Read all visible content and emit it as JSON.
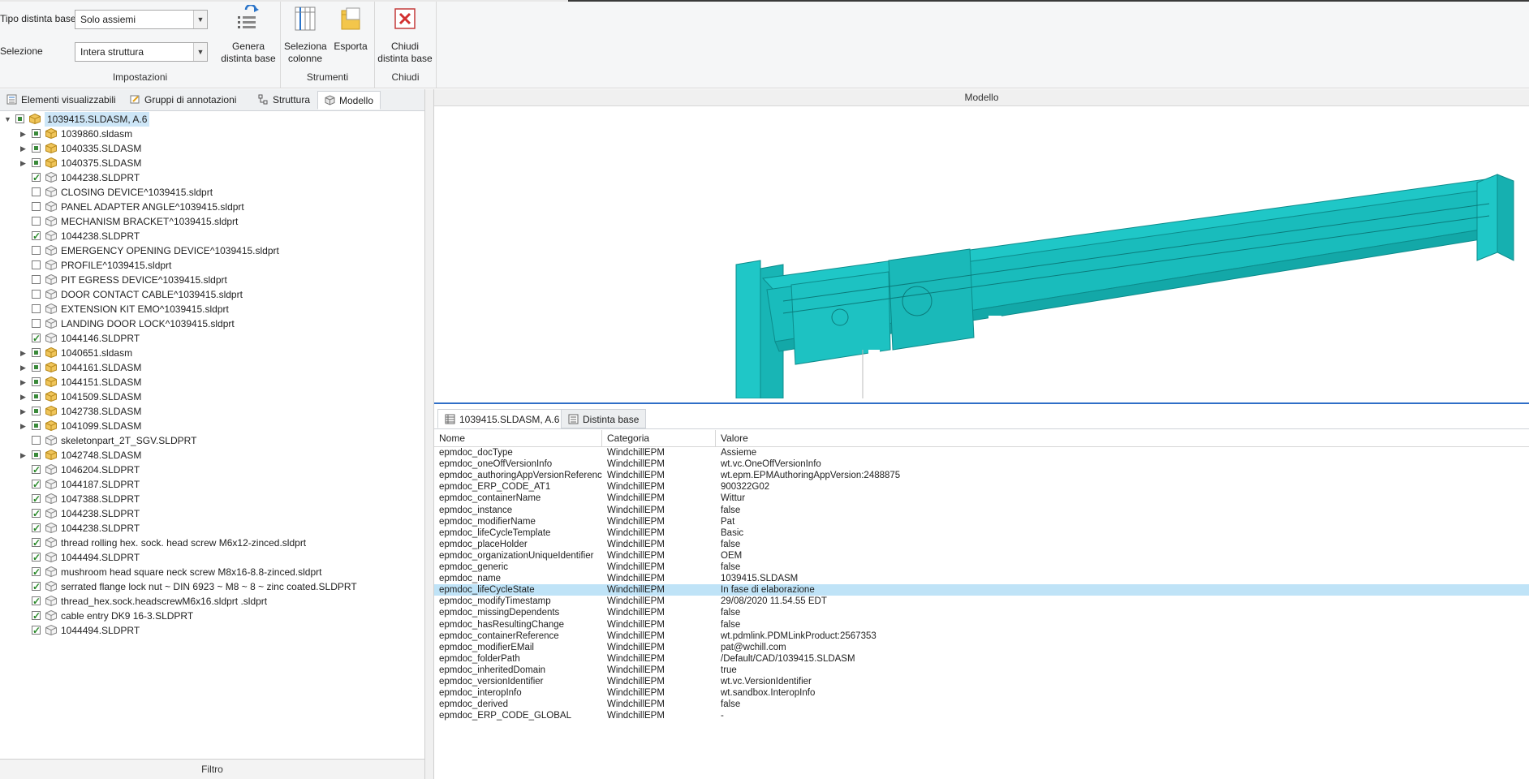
{
  "ribbon": {
    "settings": {
      "tipo_label": "Tipo distinta base",
      "tipo_value": "Solo assiemi",
      "selezione_label": "Selezione",
      "selezione_value": "Intera struttura",
      "title": "Impostazioni",
      "genera_label_1": "Genera",
      "genera_label_2": "distinta base"
    },
    "tools": {
      "title": "Strumenti",
      "seleziona_1": "Seleziona",
      "seleziona_2": "colonne",
      "esporta": "Esporta"
    },
    "close": {
      "title": "Chiudi",
      "chiudi_1": "Chiudi",
      "chiudi_2": "distinta base"
    }
  },
  "left_tabs": [
    "Elementi visualizzabili",
    "Gruppi di annotazioni",
    "Struttura",
    "Modello"
  ],
  "tree": {
    "root": "1039415.SLDASM, A.6",
    "items": [
      {
        "name": "1039860.sldasm",
        "expandable": true,
        "check": "part",
        "icon": "assembly"
      },
      {
        "name": "1040335.SLDASM",
        "expandable": true,
        "check": "part",
        "icon": "assembly"
      },
      {
        "name": "1040375.SLDASM",
        "expandable": true,
        "check": "part",
        "icon": "assembly"
      },
      {
        "name": "1044238.SLDPRT",
        "expandable": false,
        "check": "on",
        "icon": "part"
      },
      {
        "name": "CLOSING DEVICE^1039415.sldprt",
        "expandable": false,
        "check": "off",
        "icon": "part"
      },
      {
        "name": "PANEL ADAPTER ANGLE^1039415.sldprt",
        "expandable": false,
        "check": "off",
        "icon": "part"
      },
      {
        "name": "MECHANISM BRACKET^1039415.sldprt",
        "expandable": false,
        "check": "off",
        "icon": "part"
      },
      {
        "name": "1044238.SLDPRT",
        "expandable": false,
        "check": "on",
        "icon": "part"
      },
      {
        "name": "EMERGENCY OPENING DEVICE^1039415.sldprt",
        "expandable": false,
        "check": "off",
        "icon": "part"
      },
      {
        "name": "PROFILE^1039415.sldprt",
        "expandable": false,
        "check": "off",
        "icon": "part"
      },
      {
        "name": "PIT EGRESS DEVICE^1039415.sldprt",
        "expandable": false,
        "check": "off",
        "icon": "part"
      },
      {
        "name": "DOOR CONTACT CABLE^1039415.sldprt",
        "expandable": false,
        "check": "off",
        "icon": "part"
      },
      {
        "name": "EXTENSION KIT EMO^1039415.sldprt",
        "expandable": false,
        "check": "off",
        "icon": "part"
      },
      {
        "name": "LANDING DOOR LOCK^1039415.sldprt",
        "expandable": false,
        "check": "off",
        "icon": "part"
      },
      {
        "name": "1044146.SLDPRT",
        "expandable": false,
        "check": "on",
        "icon": "part"
      },
      {
        "name": "1040651.sldasm",
        "expandable": true,
        "check": "part",
        "icon": "assembly"
      },
      {
        "name": "1044161.SLDASM",
        "expandable": true,
        "check": "part",
        "icon": "assembly"
      },
      {
        "name": "1044151.SLDASM",
        "expandable": true,
        "check": "part",
        "icon": "assembly"
      },
      {
        "name": "1041509.SLDASM",
        "expandable": true,
        "check": "part",
        "icon": "assembly"
      },
      {
        "name": "1042738.SLDASM",
        "expandable": true,
        "check": "part",
        "icon": "assembly"
      },
      {
        "name": "1041099.SLDASM",
        "expandable": true,
        "check": "part",
        "icon": "assembly"
      },
      {
        "name": "skeletonpart_2T_SGV.SLDPRT",
        "expandable": false,
        "check": "off",
        "icon": "part"
      },
      {
        "name": "1042748.SLDASM",
        "expandable": true,
        "check": "part",
        "icon": "assembly"
      },
      {
        "name": "1046204.SLDPRT",
        "expandable": false,
        "check": "on",
        "icon": "part"
      },
      {
        "name": "1044187.SLDPRT",
        "expandable": false,
        "check": "on",
        "icon": "part"
      },
      {
        "name": "1047388.SLDPRT",
        "expandable": false,
        "check": "on",
        "icon": "part"
      },
      {
        "name": "1044238.SLDPRT",
        "expandable": false,
        "check": "on",
        "icon": "part"
      },
      {
        "name": "1044238.SLDPRT",
        "expandable": false,
        "check": "on",
        "icon": "part"
      },
      {
        "name": "thread rolling hex. sock. head screw M6x12-zinced.sldprt",
        "expandable": false,
        "check": "on",
        "icon": "part"
      },
      {
        "name": "1044494.SLDPRT",
        "expandable": false,
        "check": "on",
        "icon": "part"
      },
      {
        "name": "mushroom head square neck screw M8x16-8.8-zinced.sldprt",
        "expandable": false,
        "check": "on",
        "icon": "part"
      },
      {
        "name": "serrated flange lock nut ~ DIN 6923 ~ M8 ~ 8 ~ zinc coated.SLDPRT",
        "expandable": false,
        "check": "on",
        "icon": "part"
      },
      {
        "name": "thread_hex.sock.headscrewM6x16.sldprt .sldprt",
        "expandable": false,
        "check": "on",
        "icon": "part"
      },
      {
        "name": "cable entry DK9 16-3.SLDPRT",
        "expandable": false,
        "check": "on",
        "icon": "part"
      },
      {
        "name": "1044494.SLDPRT",
        "expandable": false,
        "check": "on",
        "icon": "part"
      }
    ]
  },
  "filtro": "Filtro",
  "model": {
    "header": "Modello"
  },
  "props_tabs": [
    "1039415.SLDASM, A.6",
    "Distinta base"
  ],
  "table": {
    "headers": [
      "Nome",
      "Categoria",
      "Valore"
    ],
    "selected_index": 12,
    "rows": [
      [
        "epmdoc_docType",
        "WindchillEPM",
        "Assieme"
      ],
      [
        "epmdoc_oneOffVersionInfo",
        "WindchillEPM",
        "wt.vc.OneOffVersionInfo"
      ],
      [
        "epmdoc_authoringAppVersionReference",
        "WindchillEPM",
        "wt.epm.EPMAuthoringAppVersion:2488875"
      ],
      [
        "epmdoc_ERP_CODE_AT1",
        "WindchillEPM",
        "900322G02"
      ],
      [
        "epmdoc_containerName",
        "WindchillEPM",
        "Wittur"
      ],
      [
        "epmdoc_instance",
        "WindchillEPM",
        "false"
      ],
      [
        "epmdoc_modifierName",
        "WindchillEPM",
        "Pat"
      ],
      [
        "epmdoc_lifeCycleTemplate",
        "WindchillEPM",
        "Basic"
      ],
      [
        "epmdoc_placeHolder",
        "WindchillEPM",
        "false"
      ],
      [
        "epmdoc_organizationUniqueIdentifier",
        "WindchillEPM",
        "OEM"
      ],
      [
        "epmdoc_generic",
        "WindchillEPM",
        "false"
      ],
      [
        "epmdoc_name",
        "WindchillEPM",
        "1039415.SLDASM"
      ],
      [
        "epmdoc_lifeCycleState",
        "WindchillEPM",
        "In fase di elaborazione"
      ],
      [
        "epmdoc_modifyTimestamp",
        "WindchillEPM",
        "29/08/2020 11.54.55 EDT"
      ],
      [
        "epmdoc_missingDependents",
        "WindchillEPM",
        "false"
      ],
      [
        "epmdoc_hasResultingChange",
        "WindchillEPM",
        "false"
      ],
      [
        "epmdoc_containerReference",
        "WindchillEPM",
        "wt.pdmlink.PDMLinkProduct:2567353"
      ],
      [
        "epmdoc_modifierEMail",
        "WindchillEPM",
        "pat@wchill.com"
      ],
      [
        "epmdoc_folderPath",
        "WindchillEPM",
        "/Default/CAD/1039415.SLDASM"
      ],
      [
        "epmdoc_inheritedDomain",
        "WindchillEPM",
        "true"
      ],
      [
        "epmdoc_versionIdentifier",
        "WindchillEPM",
        "wt.vc.VersionIdentifier"
      ],
      [
        "epmdoc_interopInfo",
        "WindchillEPM",
        "wt.sandbox.InteropInfo"
      ],
      [
        "epmdoc_derived",
        "WindchillEPM",
        "false"
      ],
      [
        "epmdoc_ERP_CODE_GLOBAL",
        "WindchillEPM",
        "-"
      ]
    ]
  },
  "colors": {
    "model_cyan": "#1fc7c7",
    "selection": "#bfe3f7",
    "accent_blue": "#2f6ec7"
  }
}
